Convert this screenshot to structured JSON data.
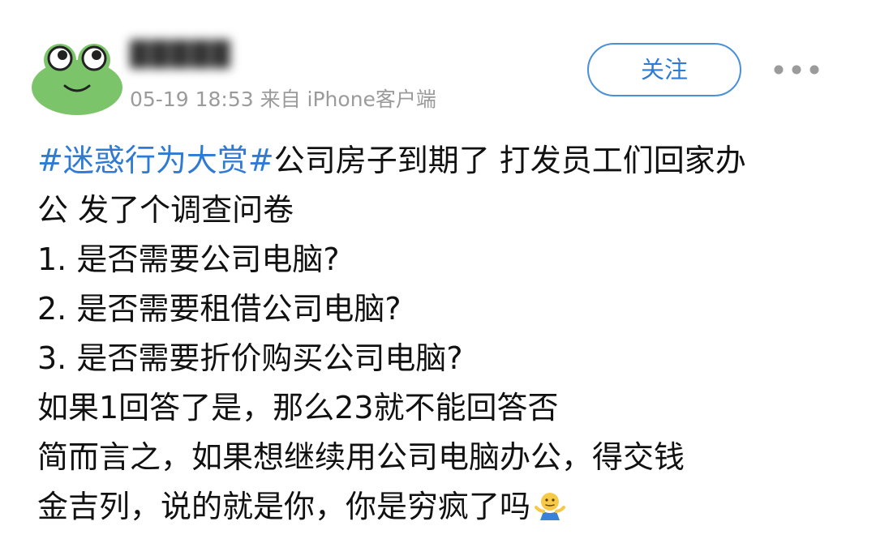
{
  "post": {
    "author_name": "█████",
    "timestamp": "05-19 18:53",
    "source": "来自 iPhone客户端",
    "follow_label": "关注",
    "body": {
      "topic": "#迷惑行为大赏#",
      "line1_rest": "公司房子到期了 打发员工们回家办",
      "line2": "公 发了个调查问卷",
      "line3": "1. 是否需要公司电脑?",
      "line4": "2. 是否需要租借公司电脑?",
      "line5": "3. 是否需要折价购买公司电脑?",
      "line6": "如果1回答了是，那么23就不能回答否",
      "line7": "简而言之，如果想继续用公司电脑办公，得交钱",
      "line8": "金吉列，说的就是你，你是穷疯了吗"
    }
  },
  "icons": {
    "avatar": "frog-avatar-icon",
    "more": "more-dots-icon",
    "emoji": "shrug-emoji-icon"
  },
  "colors": {
    "accent": "#2f7bd3",
    "follow_border": "#4a90d9",
    "meta_text": "#9b9b9b",
    "avatar_green": "#7cc46a"
  }
}
